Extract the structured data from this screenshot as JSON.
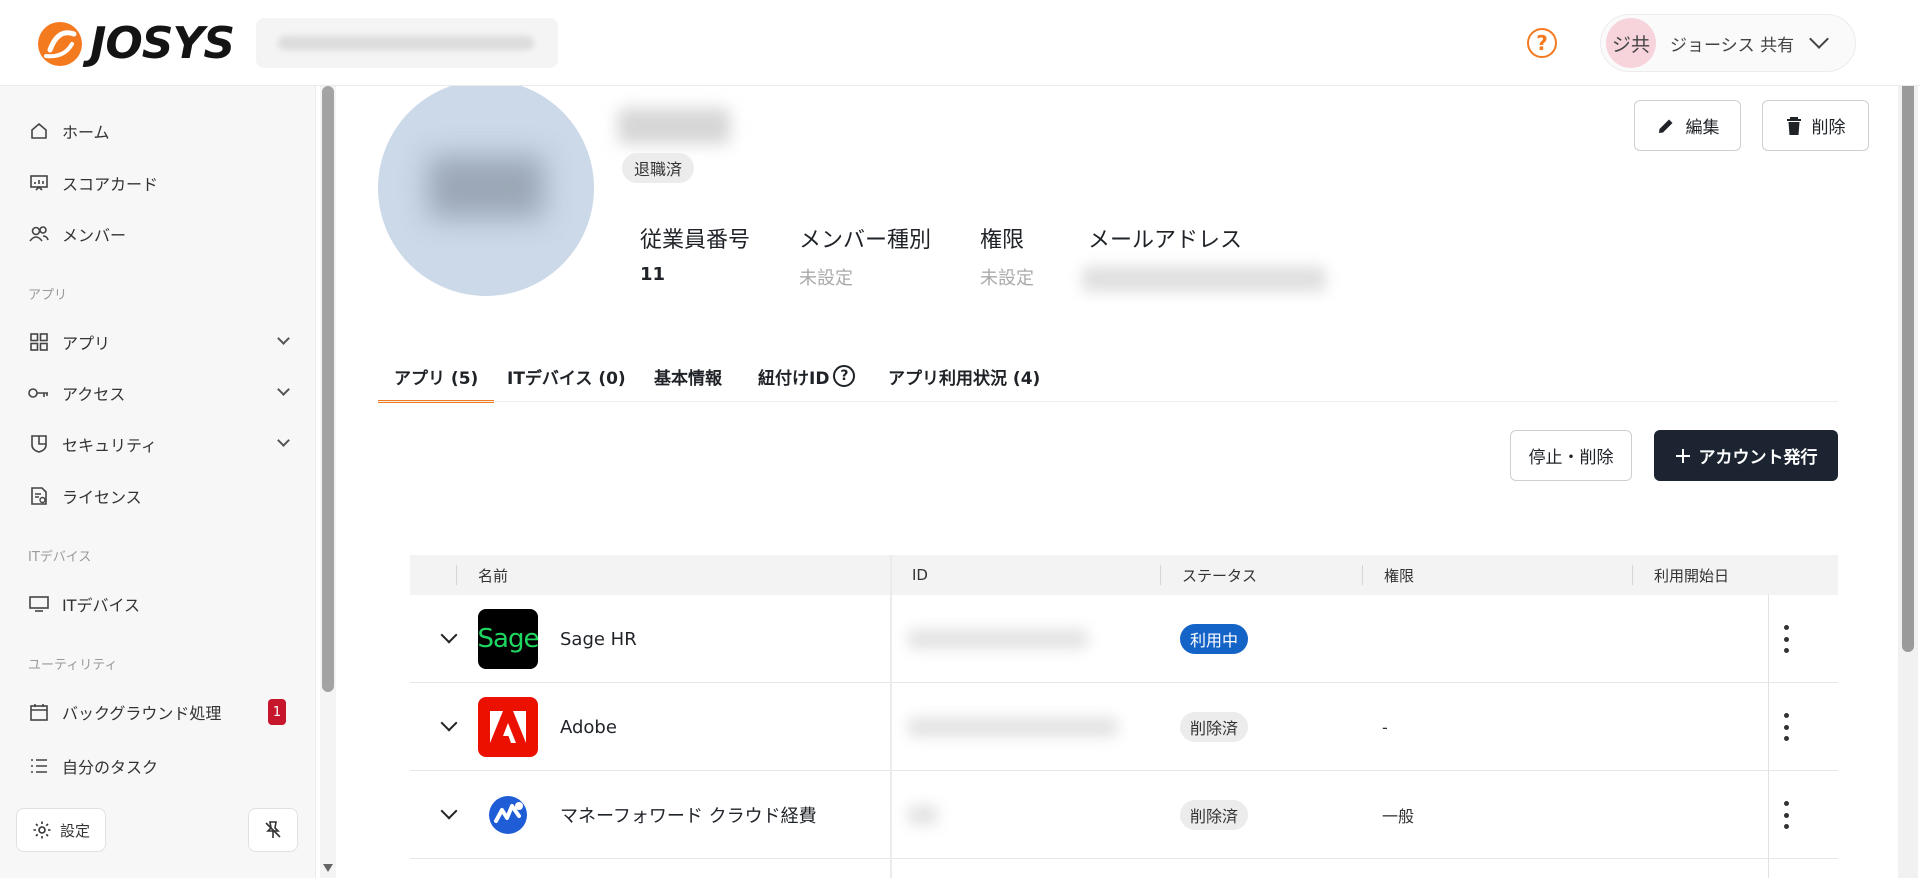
{
  "header": {
    "logo_text": "JOSYS",
    "help_icon": "question-circle-icon",
    "user_initials": "ジ共",
    "user_name": "ジョーシス 共有"
  },
  "sidebar": {
    "items": [
      {
        "label": "ホーム",
        "icon": "home-icon"
      },
      {
        "label": "スコアカード",
        "icon": "scorecard-icon"
      },
      {
        "label": "メンバー",
        "icon": "members-icon"
      }
    ],
    "section_apps": "アプリ",
    "app_items": [
      {
        "label": "アプリ",
        "icon": "grid-icon"
      },
      {
        "label": "アクセス",
        "icon": "key-icon"
      },
      {
        "label": "セキュリティ",
        "icon": "shield-icon"
      },
      {
        "label": "ライセンス",
        "icon": "license-icon"
      }
    ],
    "section_devices": "ITデバイス",
    "device_items": [
      {
        "label": "ITデバイス",
        "icon": "monitor-icon"
      }
    ],
    "section_utility": "ユーティリティ",
    "utility_items": [
      {
        "label": "バックグラウンド処理",
        "icon": "calendar-icon",
        "badge": "1"
      },
      {
        "label": "自分のタスク",
        "icon": "tasks-icon"
      }
    ],
    "settings_label": "設定"
  },
  "profile": {
    "status": "退職済",
    "edit_label": "編集",
    "delete_label": "削除",
    "fields": [
      {
        "label": "従業員番号",
        "value": "11"
      },
      {
        "label": "メンバー種別",
        "value": "未設定"
      },
      {
        "label": "権限",
        "value": "未設定"
      },
      {
        "label": "メールアドレス",
        "value": ""
      }
    ]
  },
  "tabs": [
    {
      "label": "アプリ (5)",
      "active": true
    },
    {
      "label": "ITデバイス (0)"
    },
    {
      "label": "基本情報"
    },
    {
      "label": "紐付けID"
    },
    {
      "label": "アプリ利用状況 (4)"
    }
  ],
  "actions": {
    "stop_delete_label": "停止・削除",
    "issue_account_label": "アカウント発行"
  },
  "table": {
    "columns": [
      "名前",
      "ID",
      "ステータス",
      "権限",
      "利用開始日"
    ],
    "rows": [
      {
        "name": "Sage HR",
        "logo": "sage-logo",
        "logo_text": "Sage",
        "status": "利用中",
        "status_type": "active",
        "permission": ""
      },
      {
        "name": "Adobe",
        "logo": "adobe-logo",
        "status": "削除済",
        "status_type": "deleted",
        "permission": "-"
      },
      {
        "name": "マネーフォワード クラウド経費",
        "logo": "moneyforward-logo",
        "status": "削除済",
        "status_type": "deleted",
        "permission": "一般"
      }
    ]
  },
  "colors": {
    "accent": "#f47a20",
    "primary_dark": "#1b2430",
    "status_active": "#1464c8",
    "badge_red": "#c7162b"
  }
}
